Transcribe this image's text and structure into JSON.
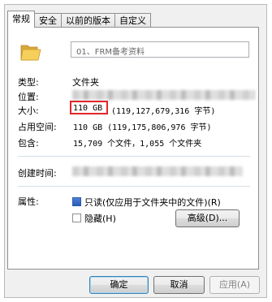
{
  "tabs": [
    "常规",
    "安全",
    "以前的版本",
    "自定义"
  ],
  "folder_name": "01、FRM备考资料",
  "rows": {
    "type_label": "类型:",
    "type_value": "文件夹",
    "location_label": "位置:",
    "size_label": "大小:",
    "size_highlight": "110 GB",
    "size_bytes": "(119,127,679,316 字节)",
    "disk_size_label": "占用空间:",
    "disk_size_value": "110 GB (119,175,806,976 字节)",
    "contains_label": "包含:",
    "contains_value": "15,709 个文件，1,055 个文件夹",
    "created_label": "创建时间:",
    "attributes_label": "属性:"
  },
  "attributes": {
    "readonly": "只读(仅应用于文件夹中的文件)(R)",
    "hidden": "隐藏(H)",
    "advanced": "高级(D)..."
  },
  "buttons": {
    "ok": "确定",
    "cancel": "取消",
    "apply": "应用(A)"
  },
  "colors": {
    "highlight_box": "#e3262a",
    "checkbox_checked": "#2a5cb8"
  }
}
